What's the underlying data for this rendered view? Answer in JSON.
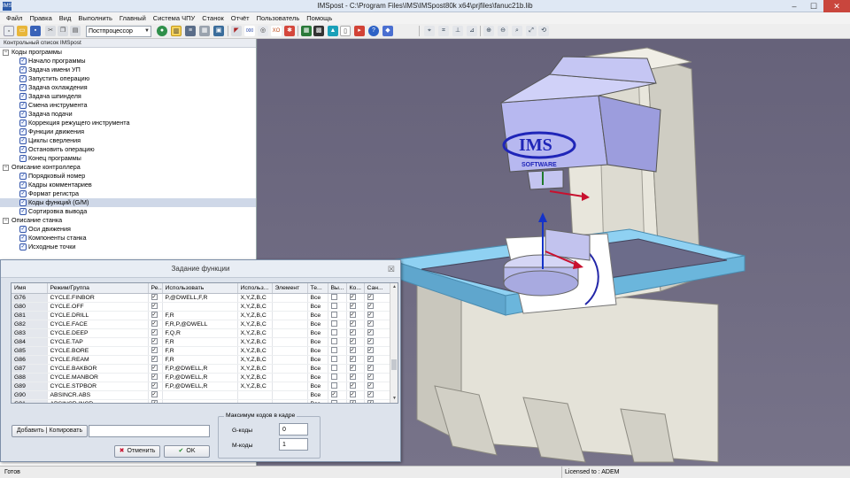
{
  "window": {
    "app_icon": "IMS",
    "title": "IMSpost - C:\\Program Files\\IMS\\IMSpost80k x64\\prjfiles\\fanuc21b.lib"
  },
  "menu": [
    "Файл",
    "Правка",
    "Вид",
    "Выполнить",
    "Главный",
    "Система ЧПУ",
    "Станок",
    "Отчёт",
    "Пользователь",
    "Помощь"
  ],
  "toolbar": {
    "combo_value": "Постпроцессор"
  },
  "left_panel": {
    "header": "Контрольный список IMSpost",
    "tree": [
      {
        "type": "group",
        "label": "Коды программы"
      },
      {
        "type": "item",
        "label": "Начало программы"
      },
      {
        "type": "item",
        "label": "Задача имени УП"
      },
      {
        "type": "item",
        "label": "Запустить операцию"
      },
      {
        "type": "item",
        "label": "Задача охлаждения"
      },
      {
        "type": "item",
        "label": "Задача шпинделя"
      },
      {
        "type": "item",
        "label": "Смена инструмента"
      },
      {
        "type": "item",
        "label": "Задача подачи"
      },
      {
        "type": "item",
        "label": "Коррекция режущего инструмента"
      },
      {
        "type": "item",
        "label": "Функции движения"
      },
      {
        "type": "item",
        "label": "Циклы сверления"
      },
      {
        "type": "item",
        "label": "Остановить операцию"
      },
      {
        "type": "item",
        "label": "Конец программы"
      },
      {
        "type": "group",
        "label": "Описание контроллера"
      },
      {
        "type": "item",
        "label": "Порядковый номер"
      },
      {
        "type": "item",
        "label": "Кадры комментариев"
      },
      {
        "type": "item",
        "label": "Формат регистра"
      },
      {
        "type": "item",
        "label": "Коды функций (G/M)",
        "selected": true
      },
      {
        "type": "item",
        "label": "Сортировка вывода"
      },
      {
        "type": "group",
        "label": "Описание станка"
      },
      {
        "type": "item",
        "label": "Оси движения"
      },
      {
        "type": "item",
        "label": "Компоненты станка"
      },
      {
        "type": "item",
        "label": "Исходные точки"
      }
    ]
  },
  "viewport": {
    "logo_top": "IMS",
    "logo_bottom": "SOFTWARE"
  },
  "dialog": {
    "title": "Задание функции",
    "columns": [
      "Имя",
      "Режим/Группа",
      "Ре...",
      "Использовать",
      "Использ...",
      "Элемент",
      "Те...",
      "Вы...",
      "Ко...",
      "Сан..."
    ],
    "rows": [
      {
        "name": "G76",
        "mode": "CYCLE.FINBOR",
        "use": "P,@DWELL,F,R",
        "used": "X,Y,Z,B,C",
        "te": "Все",
        "c3": true,
        "c8": false,
        "c9": true,
        "c10": true
      },
      {
        "name": "G80",
        "mode": "CYCLE.OFF",
        "use": "",
        "used": "X,Y,Z,B,C",
        "te": "Все",
        "c3": true,
        "c8": false,
        "c9": true,
        "c10": true
      },
      {
        "name": "G81",
        "mode": "CYCLE.DRILL",
        "use": "F,R",
        "used": "X,Y,Z,B,C",
        "te": "Все",
        "c3": true,
        "c8": false,
        "c9": true,
        "c10": true
      },
      {
        "name": "G82",
        "mode": "CYCLE.FACE",
        "use": "F,R,P,@DWELL",
        "used": "X,Y,Z,B,C",
        "te": "Все",
        "c3": true,
        "c8": false,
        "c9": true,
        "c10": true
      },
      {
        "name": "G83",
        "mode": "CYCLE.DEEP",
        "use": "F,Q,R",
        "used": "X,Y,Z,B,C",
        "te": "Все",
        "c3": true,
        "c8": false,
        "c9": true,
        "c10": true
      },
      {
        "name": "G84",
        "mode": "CYCLE.TAP",
        "use": "F,R",
        "used": "X,Y,Z,B,C",
        "te": "Все",
        "c3": true,
        "c8": false,
        "c9": true,
        "c10": true
      },
      {
        "name": "G85",
        "mode": "CYCLE.BORE",
        "use": "F,R",
        "used": "X,Y,Z,B,C",
        "te": "Все",
        "c3": true,
        "c8": false,
        "c9": true,
        "c10": true
      },
      {
        "name": "G86",
        "mode": "CYCLE.REAM",
        "use": "F,R",
        "used": "X,Y,Z,B,C",
        "te": "Все",
        "c3": true,
        "c8": false,
        "c9": true,
        "c10": true
      },
      {
        "name": "G87",
        "mode": "CYCLE.BAKBOR",
        "use": "F,P,@DWELL,R",
        "used": "X,Y,Z,B,C",
        "te": "Все",
        "c3": true,
        "c8": false,
        "c9": true,
        "c10": true
      },
      {
        "name": "G88",
        "mode": "CYCLE.MANBOR",
        "use": "F,P,@DWELL,R",
        "used": "X,Y,Z,B,C",
        "te": "Все",
        "c3": true,
        "c8": false,
        "c9": true,
        "c10": true
      },
      {
        "name": "G89",
        "mode": "CYCLE.STPBOR",
        "use": "F,P,@DWELL,R",
        "used": "X,Y,Z,B,C",
        "te": "Все",
        "c3": true,
        "c8": false,
        "c9": true,
        "c10": true
      },
      {
        "name": "G90",
        "mode": "ABSINCR.ABS",
        "use": "",
        "used": "",
        "te": "Все",
        "c3": true,
        "c8": true,
        "c9": true,
        "c10": true
      },
      {
        "name": "G91",
        "mode": "ABSINCR.INCR",
        "use": "",
        "used": "",
        "te": "Все",
        "c3": true,
        "c8": false,
        "c9": true,
        "c10": true
      }
    ],
    "add_button": "Добавить",
    "copy_button": "Копировать",
    "add_input": "",
    "max_codes_label": "Максимум кодов в кадре",
    "g_label": "G-коды",
    "g_value": "0",
    "m_label": "M-коды",
    "m_value": "1",
    "cancel_button": "Отменить",
    "ok_button": "OK"
  },
  "status": {
    "left": "Готов",
    "right": "Licensed to : ADEM"
  },
  "colors": {
    "viewport_bg": "#6e6a80",
    "machine_gray": "#e2e0d6",
    "head_blue": "#b7b8f0",
    "table_blue": "#8fd1f2",
    "logo_blue": "#1f25b8",
    "arrow_red": "#c8102e",
    "arrow_blue": "#1533c8"
  }
}
